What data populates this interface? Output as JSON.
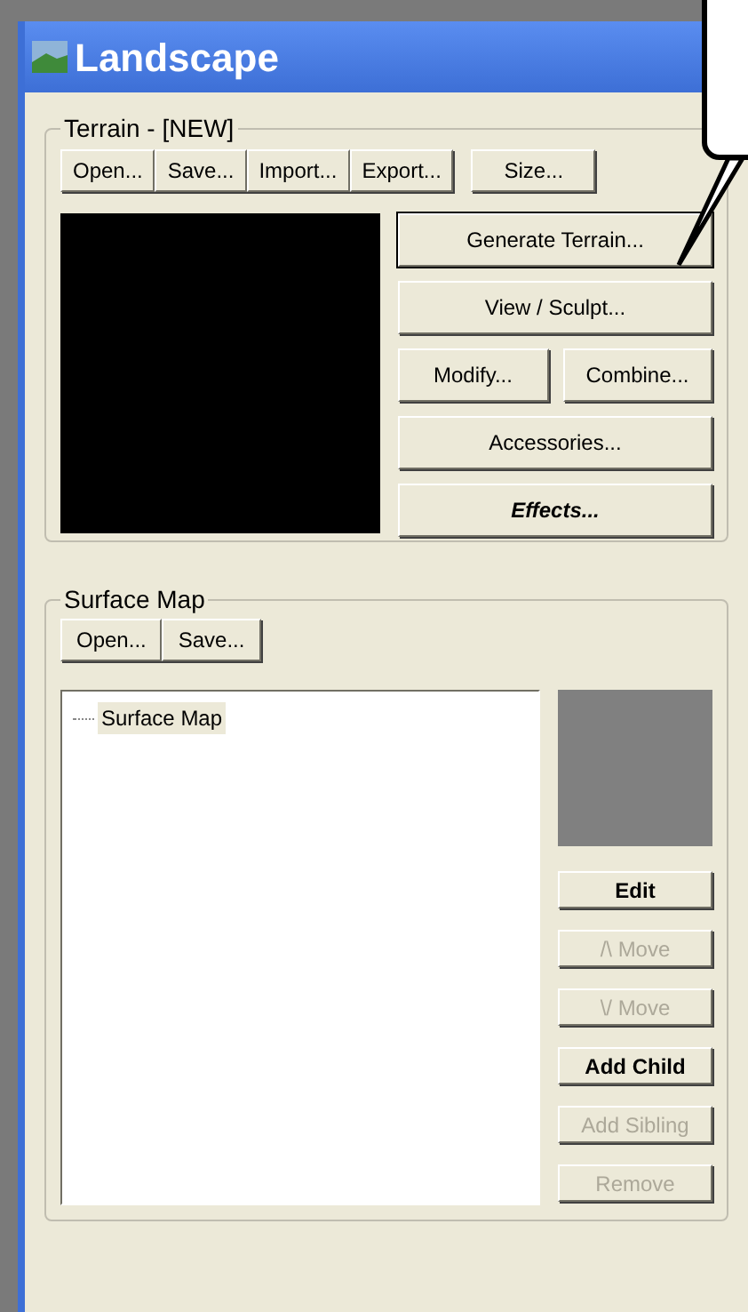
{
  "window": {
    "title": "Landscape"
  },
  "terrain": {
    "title": "Terrain - [NEW]",
    "file_buttons": [
      {
        "label": "Open..."
      },
      {
        "label": "Save..."
      },
      {
        "label": "Import..."
      },
      {
        "label": "Export..."
      }
    ],
    "size_button": {
      "label": "Size..."
    },
    "action_rows": [
      [
        {
          "label": "Generate Terrain...",
          "disabled": false,
          "focused": true
        }
      ],
      [
        {
          "label": "View / Sculpt...",
          "disabled": false,
          "focused": false
        }
      ],
      [
        {
          "label": "Modify...",
          "disabled": false,
          "focused": false
        },
        {
          "label": "Combine...",
          "disabled": false,
          "focused": false
        }
      ],
      [
        {
          "label": "Accessories...",
          "disabled": false,
          "focused": false
        }
      ],
      [
        {
          "label": "Effects...",
          "disabled": false,
          "focused": false
        }
      ]
    ]
  },
  "surface_map": {
    "title": "Surface Map",
    "file_buttons": [
      {
        "label": "Open..."
      },
      {
        "label": "Save..."
      }
    ],
    "tree": [
      {
        "label": "Surface Map",
        "selected": true
      }
    ],
    "buttons": [
      {
        "label": "Edit",
        "disabled": false
      },
      {
        "label": "/\\ Move",
        "disabled": true
      },
      {
        "label": "\\/ Move",
        "disabled": true
      },
      {
        "label": "Add Child",
        "disabled": false
      },
      {
        "label": "Add Sibling",
        "disabled": true
      },
      {
        "label": "Remove",
        "disabled": true
      }
    ]
  }
}
